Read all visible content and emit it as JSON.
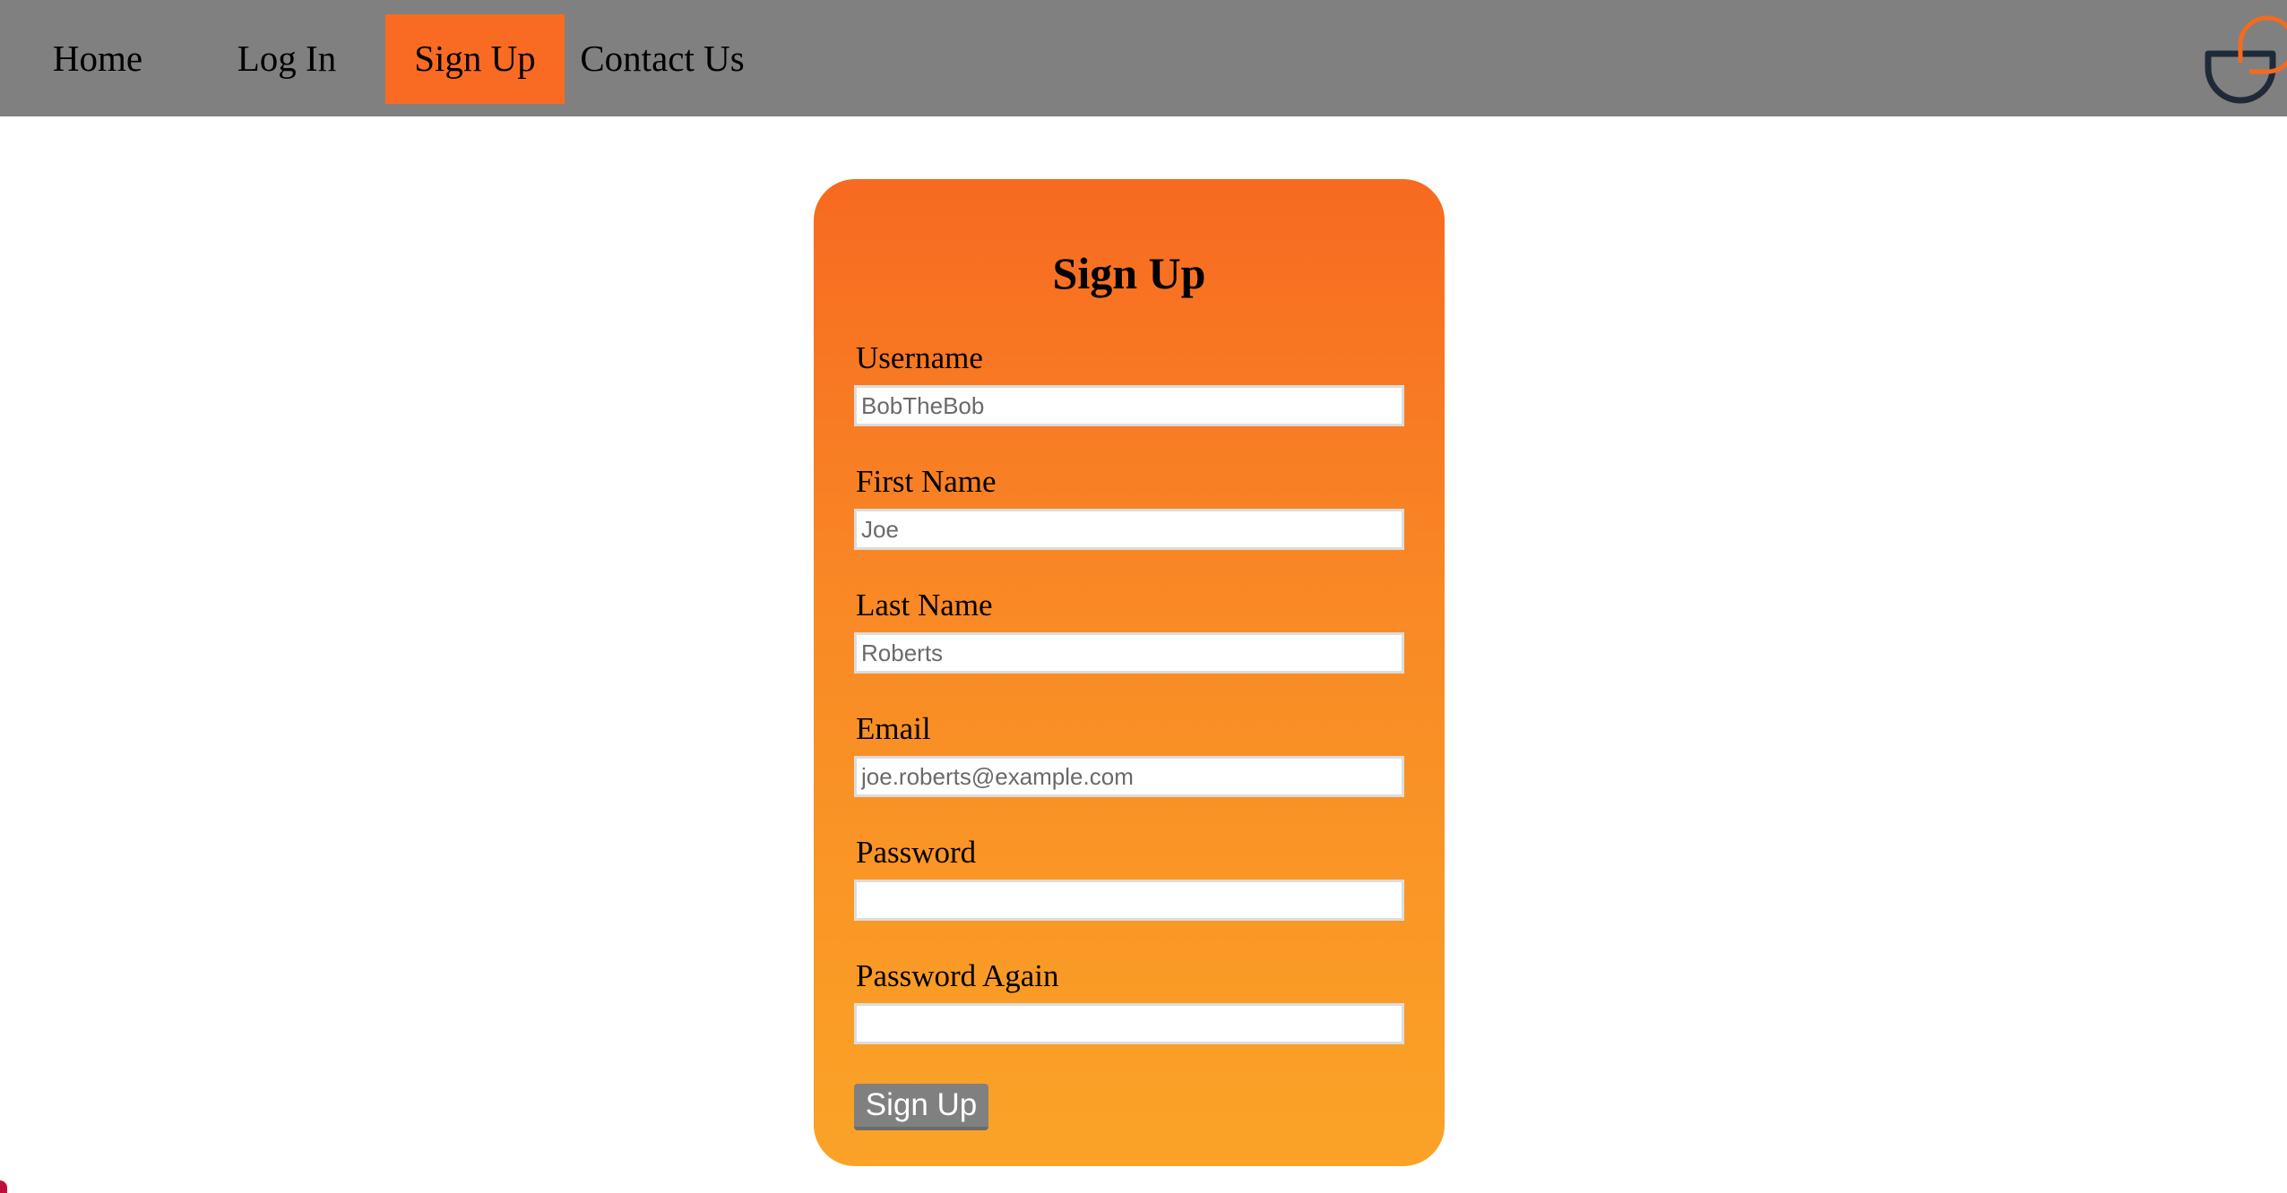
{
  "nav": {
    "items": [
      {
        "label": "Home"
      },
      {
        "label": "Log In"
      },
      {
        "label": "Sign Up",
        "active": true
      },
      {
        "label": "Contact Us"
      }
    ]
  },
  "colors": {
    "nav_bg": "#808080",
    "active_nav_bg": "#f96b22",
    "card_gradient_top": "#f76a21",
    "card_gradient_bottom": "#faa327",
    "button_bg": "#808080",
    "logo_dark": "#1f2a38",
    "logo_accent": "#f26b21"
  },
  "logo": {
    "icon": "logo-icon"
  },
  "form": {
    "title": "Sign Up",
    "fields": [
      {
        "label": "Username",
        "placeholder": "BobTheBob",
        "type": "text"
      },
      {
        "label": "First Name",
        "placeholder": "Joe",
        "type": "text"
      },
      {
        "label": "Last Name",
        "placeholder": "Roberts",
        "type": "text"
      },
      {
        "label": "Email",
        "placeholder": "joe.roberts@example.com",
        "type": "email"
      },
      {
        "label": "Password",
        "placeholder": "",
        "type": "password"
      },
      {
        "label": "Password Again",
        "placeholder": "",
        "type": "password"
      }
    ],
    "submit_label": "Sign Up"
  }
}
